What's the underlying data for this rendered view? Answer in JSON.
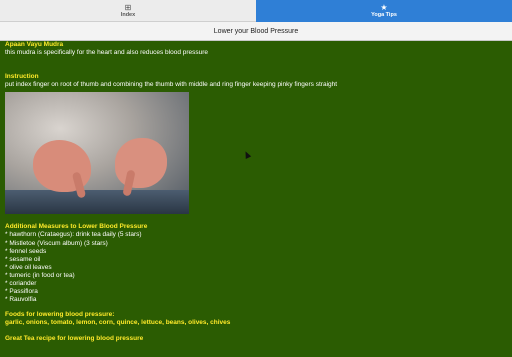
{
  "tabs": [
    {
      "label": "Index",
      "icon": "grid-icon",
      "active": false
    },
    {
      "label": "Yoga Tips",
      "icon": "star-icon",
      "active": true
    }
  ],
  "page_title": "Lower your Blood Pressure",
  "section1": {
    "heading": "Apaan Vayu Mudra",
    "text": "this mudra is specifically for the heart and also reduces blood pressure"
  },
  "section2": {
    "heading": "Instruction",
    "text": "put index finger on root of thumb and combining the thumb with middle and ring finger keeping pinky fingers straight"
  },
  "section3": {
    "heading": "Additional Measures to Lower Blood Pressure",
    "items": [
      "* hawthorn (Crataegus): drink tea daily (5 stars)",
      "* Mistletoe (Viscum album) (3 stars)",
      "* fennel seeds",
      "* sesame oil",
      "* olive oil leaves",
      "* tumeric (in food or tea)",
      "* coriander",
      "* Passiflora",
      "* Rauvolfia"
    ]
  },
  "section4": {
    "heading": "Foods for lowering blood pressure:",
    "text": "garlic, onions, tomato, lemon, corn, quince, lettuce, beans, olives, chives"
  },
  "section5": {
    "heading": "Great Tea recipe for lowering blood pressure"
  },
  "colors": {
    "background": "#2b5c02",
    "heading": "#ffea29",
    "body_text": "#ffffff",
    "active_tab": "#2f7fd6"
  }
}
